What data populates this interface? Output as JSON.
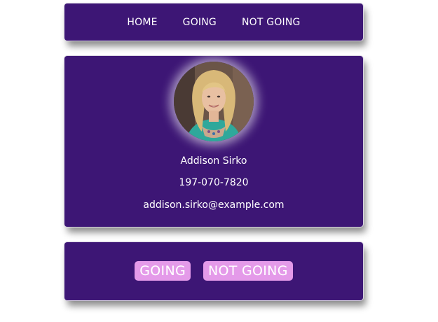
{
  "nav": {
    "items": [
      {
        "label": "HOME"
      },
      {
        "label": "GOING"
      },
      {
        "label": "NOT GOING"
      }
    ]
  },
  "profile": {
    "name": "Addison Sirko",
    "phone": "197-070-7820",
    "email": "addison.sirko@example.com"
  },
  "actions": {
    "going_label": "GOING",
    "not_going_label": "NOT GOING"
  },
  "colors": {
    "card_bg": "#3d1675",
    "button_bg": "#e49ae9",
    "text": "#ffffff"
  }
}
